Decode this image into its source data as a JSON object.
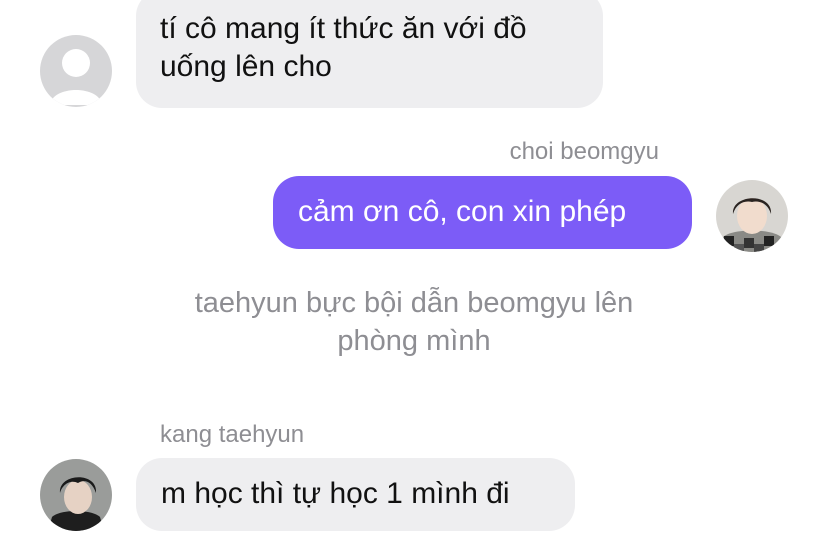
{
  "messages": [
    {
      "type": "incoming",
      "sender": "",
      "text": "tí cô mang ít thức ăn với đồ uống lên cho",
      "avatar": "default-user-avatar-icon"
    },
    {
      "type": "outgoing",
      "sender": "choi beomgyu",
      "text": "cảm ơn cô, con xin phép",
      "avatar": "beomgyu-photo"
    },
    {
      "type": "narration",
      "text": "taehyun bực bội dẫn beomgyu lên phòng mình"
    },
    {
      "type": "incoming",
      "sender": "kang taehyun",
      "text": "m học thì tự học 1 mình đi",
      "avatar": "taehyun-photo"
    }
  ],
  "colors": {
    "outgoing_bubble": "#7c5cf7",
    "incoming_bubble": "#eeeef0",
    "sender_name": "#8e8e93",
    "narration_text": "#8e8e93"
  }
}
